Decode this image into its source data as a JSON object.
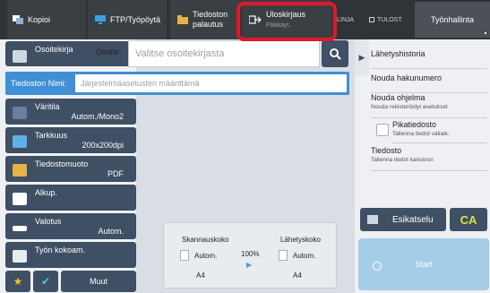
{
  "tabs": {
    "kopioi": "Kopioi",
    "ftp": "FTP/Työpöytä",
    "palautus_line1": "Tiedoston",
    "palautus_line2": "palautus",
    "ulos": "Uloskirjaus",
    "ulos_sub": "Pääkäyt.",
    "linja": "LINJA",
    "tulost": "TULOST.",
    "tyo": "Työnhallinta"
  },
  "address": {
    "book_label": "Osoitekirja",
    "label": "Osoite",
    "placeholder": "Valitse osoitekirjasta"
  },
  "filename": {
    "label": "Tiedoston Nimi:",
    "placeholder": "Järjestelmäasetusten määrittämä"
  },
  "settings": [
    {
      "label": "Väritila",
      "value": "Autom./Mono2"
    },
    {
      "label": "Tarkkuus",
      "value": "200x200dpi"
    },
    {
      "label": "Tiedostomuoto",
      "value": "PDF"
    },
    {
      "label": "Alkup.",
      "value": ""
    },
    {
      "label": "Valotus",
      "value": "Autom."
    },
    {
      "label": "Työn kokoam.",
      "value": ""
    }
  ],
  "right": {
    "historia": "Lähetyshistoria",
    "hakunumero": "Nouda hakunumero",
    "ohjelma": "Nouda ohjelma",
    "ohjelma_sub": "Nouda rekisteröidyt asetukset",
    "pikatiedosto": "Pikatiedosto",
    "pikatiedosto_sub": "Tallenna tiedot väliaik.",
    "tiedosto": "Tiedosto",
    "tiedosto_sub": "Tallenna tiedot kansioon"
  },
  "preview": {
    "esikatselu": "Esikatselu",
    "ca": "CA",
    "start": "Start"
  },
  "scan": {
    "skannauskoko": "Skannauskoko",
    "lahetyskoko": "Lähetyskoko",
    "ratio": "100%",
    "scan_auto": "Autom.",
    "scan_size": "A4",
    "send_auto": "Autom.",
    "send_size": "A4"
  },
  "bottom": {
    "muut": "Muut"
  },
  "colors": {
    "highlight": "#e0182d",
    "button": "#3f4f64",
    "filename_bar": "#3f8fd6"
  }
}
